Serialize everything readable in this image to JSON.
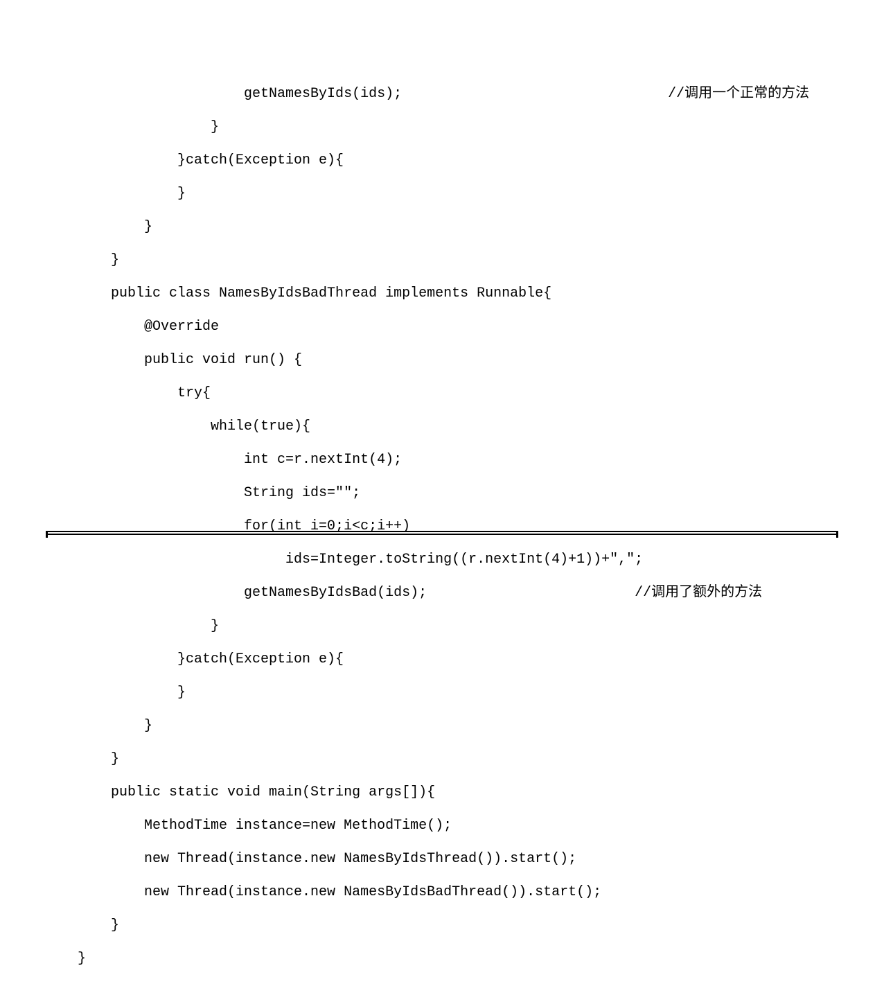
{
  "code": {
    "lines": [
      "                    getNamesByIds(ids);                                //调用一个正常的方法",
      "                }",
      "            }catch(Exception e){",
      "            }",
      "        }",
      "    }",
      "    public class NamesByIdsBadThread implements Runnable{",
      "        @Override",
      "        public void run() {",
      "            try{",
      "                while(true){",
      "                    int c=r.nextInt(4);",
      "                    String ids=\"\";",
      "                    for(int i=0;i<c;i++)",
      "                         ids=Integer.toString((r.nextInt(4)+1))+\",\";",
      "                    getNamesByIdsBad(ids);                         //调用了额外的方法",
      "                }",
      "            }catch(Exception e){",
      "            }",
      "        }",
      "    }",
      "    public static void main(String args[]){",
      "        MethodTime instance=new MethodTime();",
      "        new Thread(instance.new NamesByIdsThread()).start();",
      "        new Thread(instance.new NamesByIdsBadThread()).start();",
      "    }",
      "}"
    ]
  }
}
